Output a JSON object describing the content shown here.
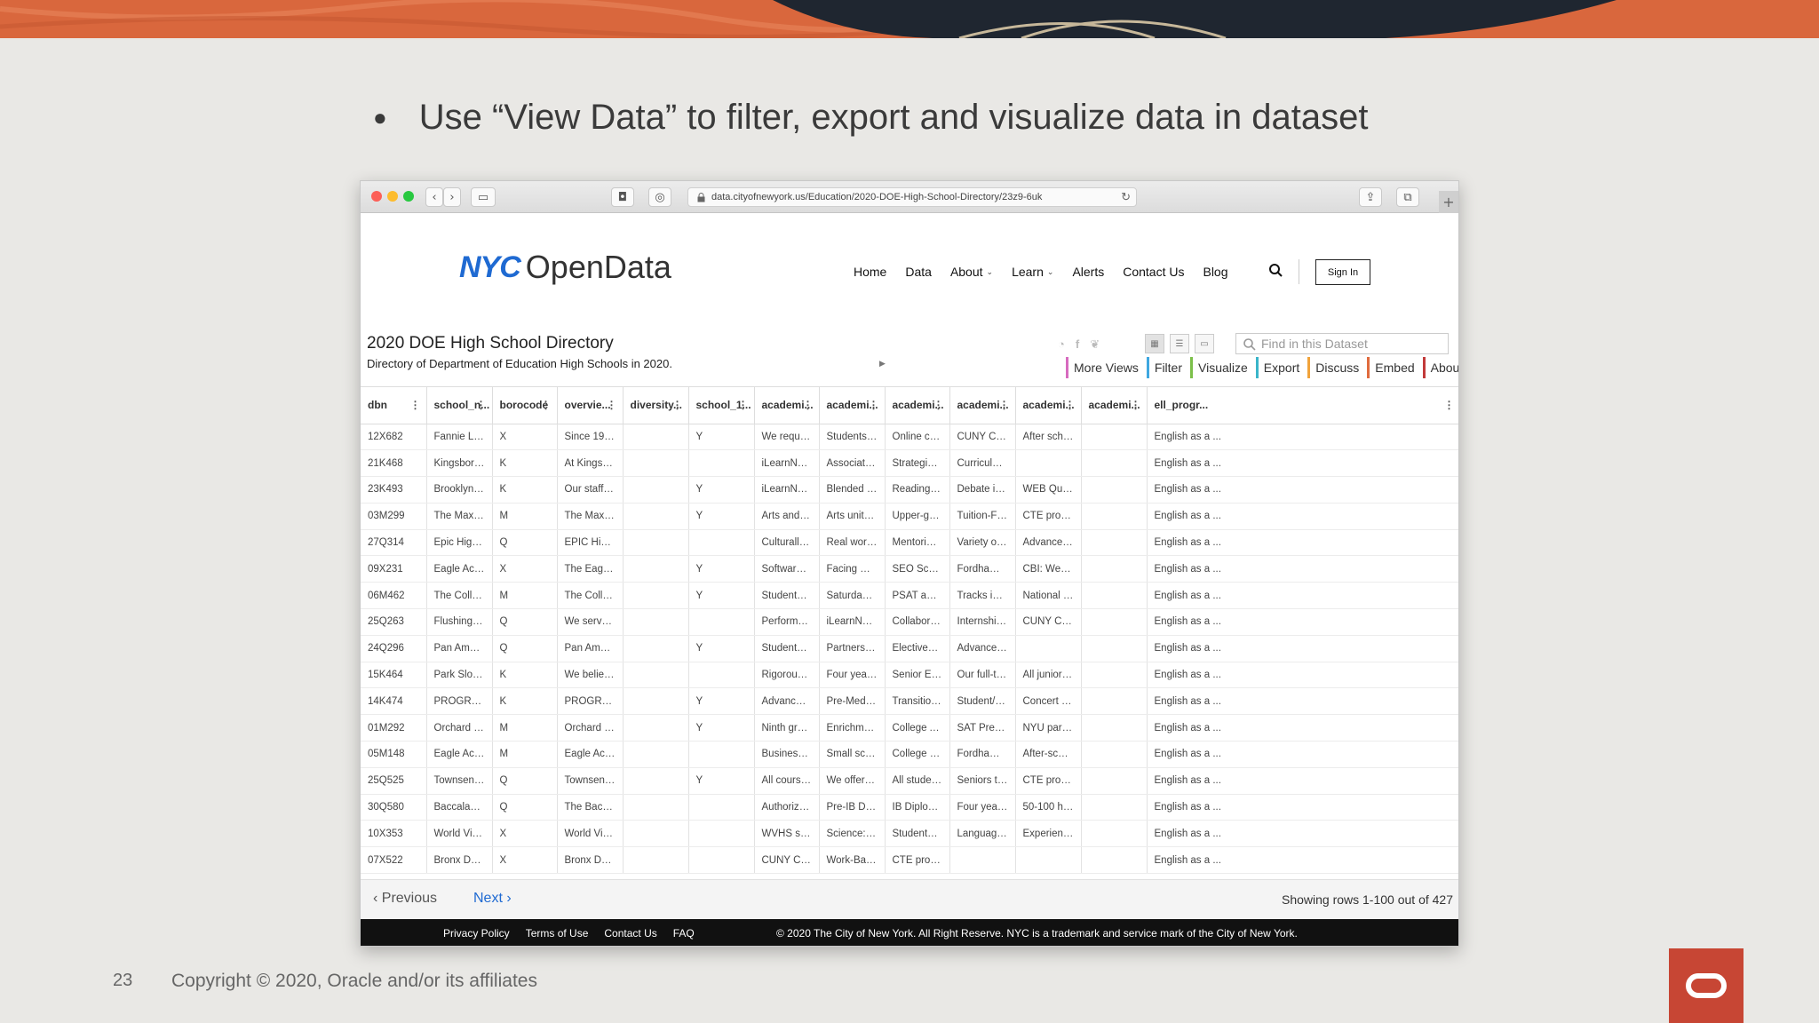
{
  "slide": {
    "bullet": "Use “View Data” to filter, export and visualize data in dataset",
    "page_number": "23",
    "copyright": "Copyright © 2020, Oracle and/or its affiliates"
  },
  "browser": {
    "url": "data.cityofnewyork.us/Education/2020-DOE-High-School-Directory/23z9-6uk"
  },
  "site": {
    "logo_mark": "NYC",
    "logo_text": "OpenData",
    "nav": [
      "Home",
      "Data",
      "About",
      "Learn",
      "Alerts",
      "Contact Us",
      "Blog"
    ],
    "sign_in": "Sign In"
  },
  "dataset": {
    "title": "2020 DOE High School Directory",
    "subtitle": "Directory of Department of Education High Schools in 2020.",
    "search_placeholder": "Find in this Dataset",
    "tabs": [
      {
        "label": "More Views",
        "color": "#d76bbf"
      },
      {
        "label": "Filter",
        "color": "#3fa7e0"
      },
      {
        "label": "Visualize",
        "color": "#7cc04a"
      },
      {
        "label": "Export",
        "color": "#3ab5c9"
      },
      {
        "label": "Discuss",
        "color": "#f1a33b"
      },
      {
        "label": "Embed",
        "color": "#e06b3e"
      },
      {
        "label": "About",
        "color": "#c23a3a"
      }
    ]
  },
  "table": {
    "headers": [
      "dbn",
      "school_n...",
      "borocode",
      "overvie...",
      "diversity...",
      "school_1...",
      "academi...",
      "academi...",
      "academi...",
      "academi...",
      "academi...",
      "academi...",
      "ell_progr..."
    ],
    "rows": [
      [
        "12X682",
        "Fannie Lou H...",
        "X",
        "Since 1994, o...",
        "",
        "Y",
        "We require a...",
        "Students cre...",
        "Online cours...",
        "CUNY Colleg...",
        "After school t...",
        "",
        "English as a ..."
      ],
      [
        "21K468",
        "Kingsboroug...",
        "K",
        "At Kingsboro...",
        "",
        "",
        "iLearnNYC: P...",
        "Associate De...",
        "Strategic Rea...",
        "Curriculum C...",
        "",
        "",
        "English as a ..."
      ],
      [
        "23K493",
        "Brooklyn Coll...",
        "K",
        "Our staff me...",
        "",
        "Y",
        "iLearnNYC: P...",
        "Blended instr...",
        "Reading and ...",
        "Debate instr...",
        "WEB Quest; L...",
        "",
        "English as a ..."
      ],
      [
        "03M299",
        "The Maxine ...",
        "M",
        "The Maxine ...",
        "",
        "Y",
        "Arts and aest...",
        "Arts units of ...",
        "Upper-grade ...",
        "Tuition-Free ...",
        "CTE program...",
        "",
        "English as a ..."
      ],
      [
        "27Q314",
        "Epic High Sch...",
        "Q",
        "EPIC High Sc...",
        "",
        "",
        "Culturally rel...",
        "Real world pr...",
        "Mentoring, Ri...",
        "Variety of coll...",
        "Advance Plac...",
        "",
        "English as a ..."
      ],
      [
        "09X231",
        "Eagle Acade...",
        "X",
        "The Eagle Ac...",
        "",
        "Y",
        "Software Eng...",
        "Facing Histor...",
        "SEO Scholars...",
        "Fordham STE...",
        "CBI: We part...",
        "",
        "English as a ..."
      ],
      [
        "06M462",
        "The College A...",
        "M",
        "The College A...",
        "",
        "Y",
        "Students wit...",
        "Saturday Aca...",
        "PSAT and SA...",
        "Tracks in STE...",
        "National Hon...",
        "",
        "English as a ..."
      ],
      [
        "25Q263",
        "Flushing Inte...",
        "Q",
        "We serve rec...",
        "",
        "",
        "Performance...",
        "iLearnNYC: P...",
        "Collaborative...",
        "Internships i...",
        "CUNY Colleg...",
        "",
        "English as a ..."
      ],
      [
        "24Q296",
        "Pan America...",
        "Q",
        "Pan America...",
        "",
        "Y",
        "Students co...",
        "Partnerships ...",
        "Electives: Ph...",
        "Advanced Pla...",
        "",
        "",
        "English as a ..."
      ],
      [
        "15K464",
        "Park Slope C...",
        "K",
        "We believe th...",
        "",
        "",
        "Rigorous curr...",
        "Four years of...",
        "Senior Englis...",
        "Our full-time ...",
        "All juniors pa...",
        "",
        "English as a ..."
      ],
      [
        "14K474",
        "PROGRESS Hi...",
        "K",
        "PROGRESS Hi...",
        "",
        "Y",
        "Advanced Pla...",
        "Pre-Med-four...",
        "Transitional ...",
        "Student/Pare...",
        "Concert Ban...",
        "",
        "English as a ..."
      ],
      [
        "01M292",
        "Orchard Coll...",
        "M",
        "Orchard Coll...",
        "",
        "Y",
        "Ninth grade li...",
        "Enrichment e...",
        "College Acces...",
        "SAT Prep cou...",
        "NYU partners...",
        "",
        "English as a ..."
      ],
      [
        "05M148",
        "Eagle Acade...",
        "M",
        "Eagle Acade...",
        "",
        "",
        "Business, La...",
        "Small school ...",
        "College and c...",
        "Fordham STE...",
        "After-school ...",
        "",
        "English as a ..."
      ],
      [
        "25Q525",
        "Townsend H...",
        "Q",
        "Townsend H...",
        "",
        "Y",
        "All courses ar...",
        "We offer Con...",
        "All students s...",
        "Seniors take ...",
        "CTE program...",
        "",
        "English as a ..."
      ],
      [
        "30Q580",
        "Baccalaureat...",
        "Q",
        "The Baccalau...",
        "",
        "",
        "Authorized b...",
        "Pre-IB Diplo...",
        "IB Diploma e...",
        "Four years of...",
        "50-100 hours...",
        "",
        "English as a ..."
      ],
      [
        "10X353",
        "World View H...",
        "X",
        "World View H...",
        "",
        "",
        "WVHS studen...",
        "Science: Envi...",
        "Students in t...",
        "Language/Cu...",
        "Experiential l...",
        "",
        "English as a ..."
      ],
      [
        "07X522",
        "Bronx Design...",
        "X",
        "Bronx Design...",
        "",
        "",
        "CUNY Colleg...",
        "Work-Based ...",
        "CTE program...",
        "",
        "",
        "",
        "English as a ..."
      ]
    ]
  },
  "pager": {
    "previous": "Previous",
    "next": "Next",
    "info": "Showing rows 1-100 out of 427"
  },
  "footer": {
    "links": [
      "Privacy Policy",
      "Terms of Use",
      "Contact Us",
      "FAQ"
    ],
    "copyright": "© 2020 The City of New York. All Right Reserve. NYC is a trademark and service mark of the City of New York."
  },
  "colors": {
    "banner": "#d9673d",
    "nyc_blue": "#1f6ad2",
    "oracle_red": "#c74634"
  }
}
